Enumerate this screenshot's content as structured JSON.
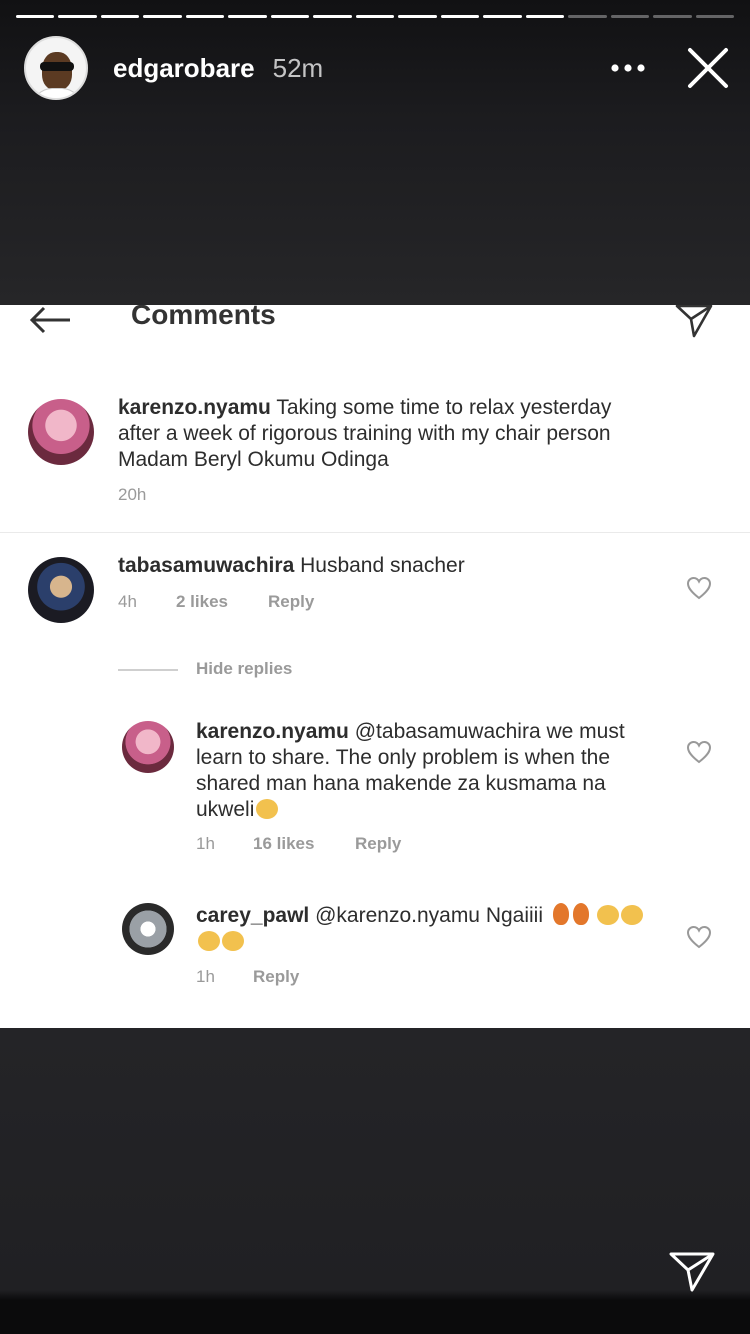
{
  "story": {
    "username": "edgarobare",
    "time": "52m",
    "progress_segments": 17,
    "progress_done": 13
  },
  "screenshot": {
    "title": "Comments",
    "caption": {
      "user": "karenzo.nyamu",
      "text": "Taking some time to relax yesterday after a week of rigorous training with my chair person Madam Beryl Okumu Odinga",
      "time": "20h"
    },
    "comments": [
      {
        "user": "tabasamuwachira",
        "text": "Husband snacher",
        "time": "4h",
        "likes": "2 likes",
        "reply": "Reply"
      }
    ],
    "hide_replies": "Hide replies",
    "replies": [
      {
        "user": "karenzo.nyamu",
        "text": "@tabasamuwachira we must learn to share. The only problem is when the shared man hana makende za kusmama na ukweli",
        "time": "1h",
        "likes": "16 likes",
        "reply": "Reply"
      },
      {
        "user": "carey_pawl",
        "text": "@karenzo.nyamu Ngaiiii",
        "time": "1h",
        "reply": "Reply"
      }
    ]
  },
  "colors": {
    "background": "#222226",
    "card": "#ffffff",
    "meta_text": "#9a9a9a"
  }
}
